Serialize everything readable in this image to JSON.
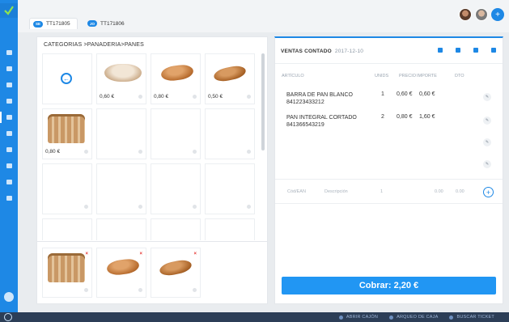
{
  "tabs": [
    {
      "badge": "SE",
      "label": "TT171805"
    },
    {
      "badge": "JO",
      "label": "TT171806"
    }
  ],
  "avatar_add": "+",
  "breadcrumb": "CATEGORIAS >PANADERIA>PANES",
  "back_symbol": "←",
  "products": [
    {
      "price": "0,60 €"
    },
    {
      "price": "0,80 €"
    },
    {
      "price": "0,50 €"
    },
    {
      "price": "0,80 €"
    }
  ],
  "selected_remove": "×",
  "sale": {
    "title": "VENTAS CONTADO",
    "date": "2017-12-10",
    "columns": {
      "article": "ARTÍCULO",
      "units": "UNIDS",
      "price": "PRECIO",
      "amount": "IMPORTE",
      "discount": "DTO"
    },
    "items": [
      {
        "name": "BARRA DE PAN BLANCO",
        "code": "841223433212",
        "units": "1",
        "price": "0,60 €",
        "amount": "0,60 €"
      },
      {
        "name": "PAN INTEGRAL CORTADO",
        "code": "841366543219",
        "units": "2",
        "price": "0,80 €",
        "amount": "1,60 €"
      }
    ],
    "input_row": {
      "code_placeholder": "Cód/EAN",
      "desc_placeholder": "Descripción",
      "qty": "1",
      "price": "0.00",
      "amount": "0.00",
      "add": "+"
    },
    "charge_label": "Cobrar: 2,20 €"
  },
  "bottom_buttons": [
    {
      "label": "ABRIR CAJÓN"
    },
    {
      "label": "ARQUEO DE CAJA"
    },
    {
      "label": "BUSCAR TICKET"
    }
  ],
  "colors": {
    "accent": "#1e88e5",
    "charge": "#2196f3",
    "bottombar": "#2c3e57"
  }
}
